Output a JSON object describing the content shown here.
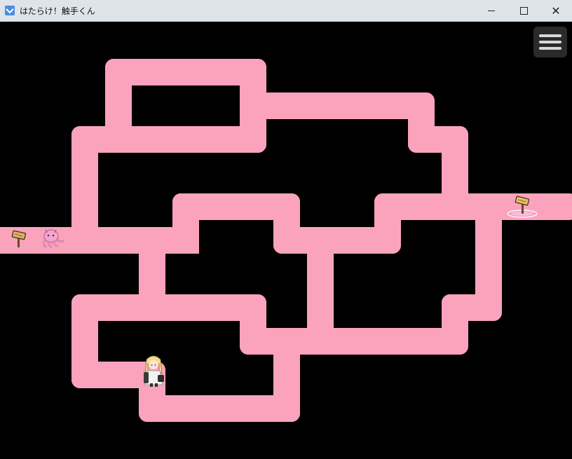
{
  "window": {
    "title": "はたらけ！触手くん",
    "minimize_icon": "minimize-icon",
    "maximize_icon": "maximize-icon",
    "close_icon": "close-icon"
  },
  "game": {
    "menu_icon": "hamburger-menu-icon",
    "path_color": "#fba3bd",
    "background_color": "#000000",
    "sprites": {
      "start_sign": "wooden-signpost-icon",
      "creature": "pink-tentacle-creature",
      "player": "blonde-girl-character",
      "goal_sign": "signpost-with-magic-circle-icon"
    }
  }
}
